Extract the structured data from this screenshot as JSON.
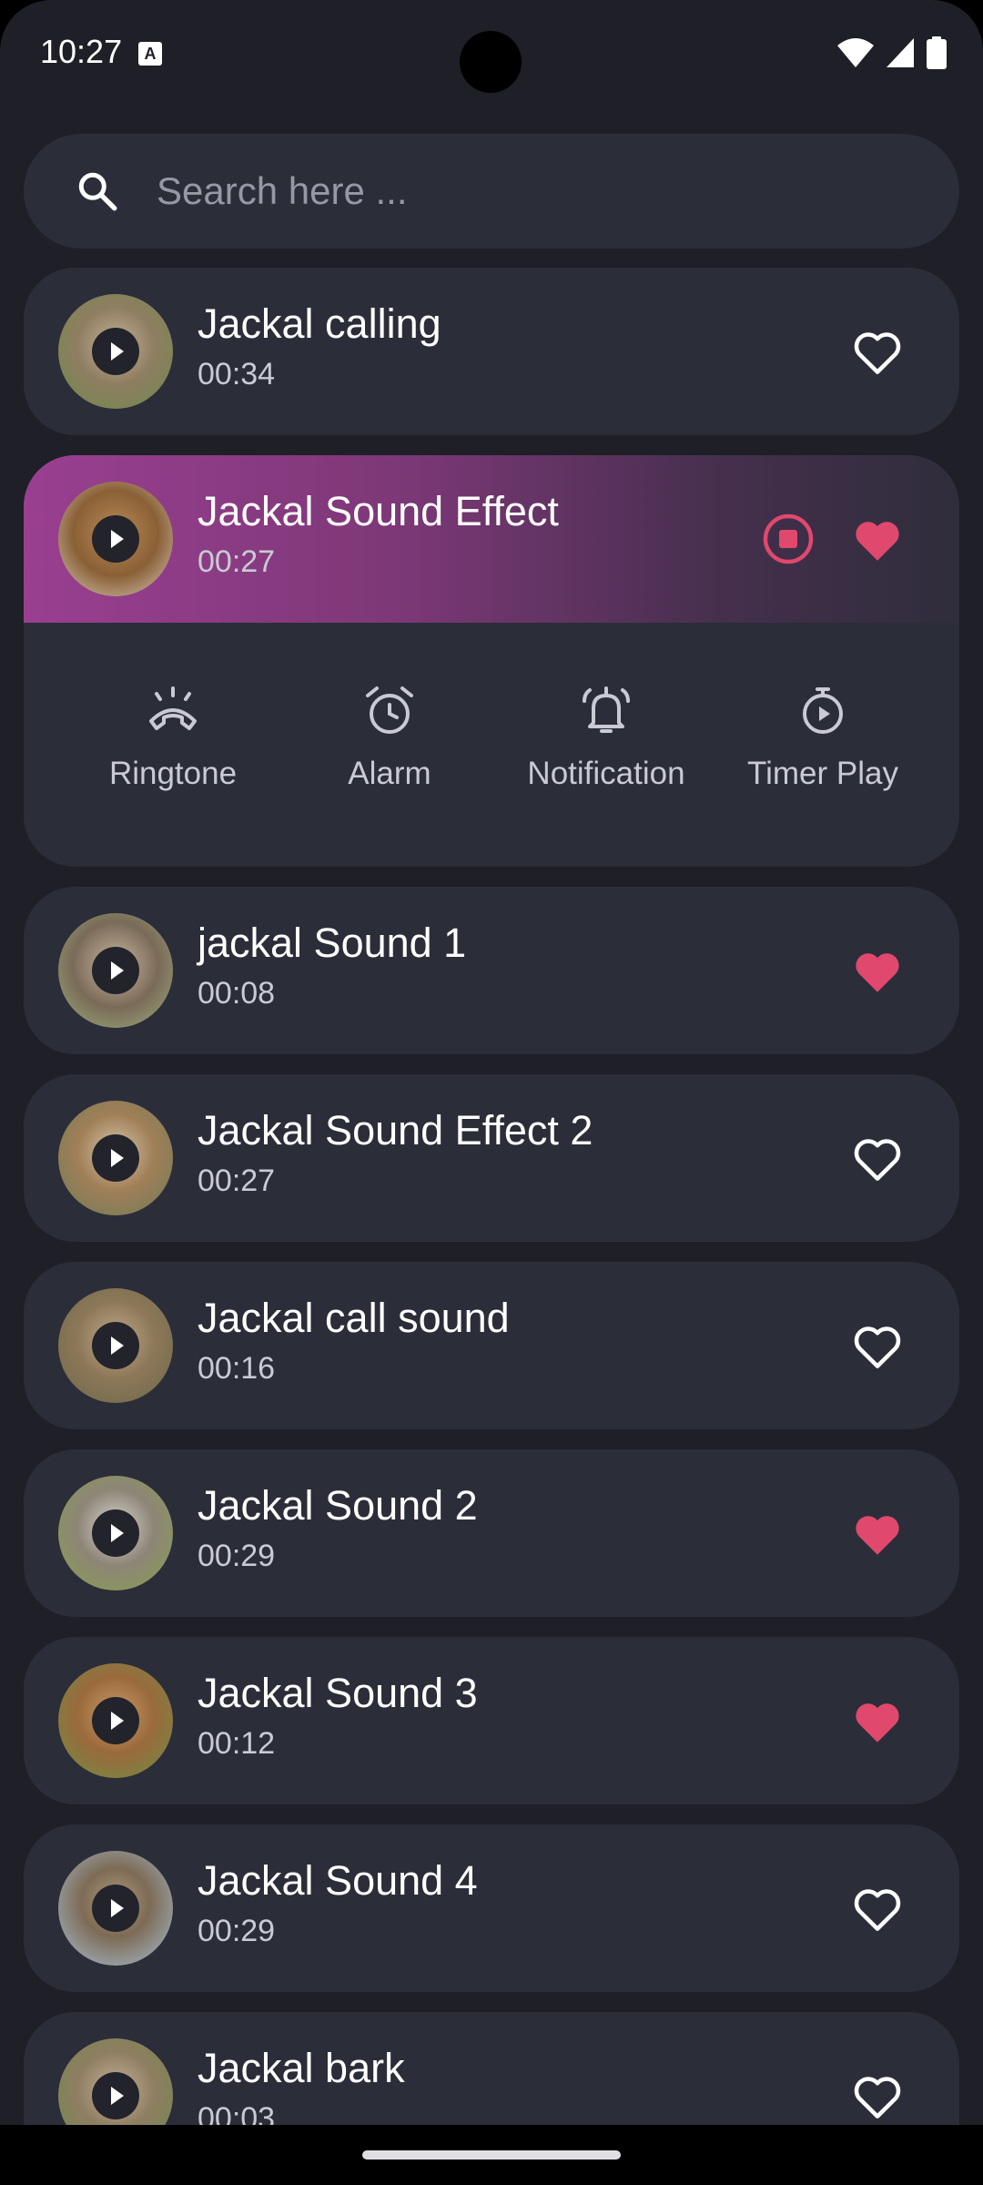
{
  "status_bar": {
    "time": "10:27"
  },
  "search": {
    "placeholder": "Search here ..."
  },
  "colors": {
    "accent": "#e0486d",
    "card_bg": "#2b2d39",
    "screen_bg": "#1e1f27",
    "expanded_gradient_start": "#9a3f91"
  },
  "sounds": [
    {
      "title": "Jackal calling",
      "duration": "00:34",
      "favorite": false
    },
    {
      "title": "Jackal Sound Effect",
      "duration": "00:27",
      "favorite": true,
      "playing": true
    },
    {
      "title": "jackal Sound 1",
      "duration": "00:08",
      "favorite": true
    },
    {
      "title": "Jackal Sound Effect 2",
      "duration": "00:27",
      "favorite": false
    },
    {
      "title": "Jackal call sound",
      "duration": "00:16",
      "favorite": false
    },
    {
      "title": "Jackal Sound 2",
      "duration": "00:29",
      "favorite": true
    },
    {
      "title": "Jackal Sound 3",
      "duration": "00:12",
      "favorite": true
    },
    {
      "title": "Jackal Sound 4",
      "duration": "00:29",
      "favorite": false
    },
    {
      "title": "Jackal bark",
      "duration": "00:03",
      "favorite": false
    }
  ],
  "actions": [
    {
      "label": "Ringtone",
      "icon": "phone-ring-icon"
    },
    {
      "label": "Alarm",
      "icon": "alarm-clock-icon"
    },
    {
      "label": "Notification",
      "icon": "bell-icon"
    },
    {
      "label": "Timer Play",
      "icon": "timer-icon"
    }
  ]
}
